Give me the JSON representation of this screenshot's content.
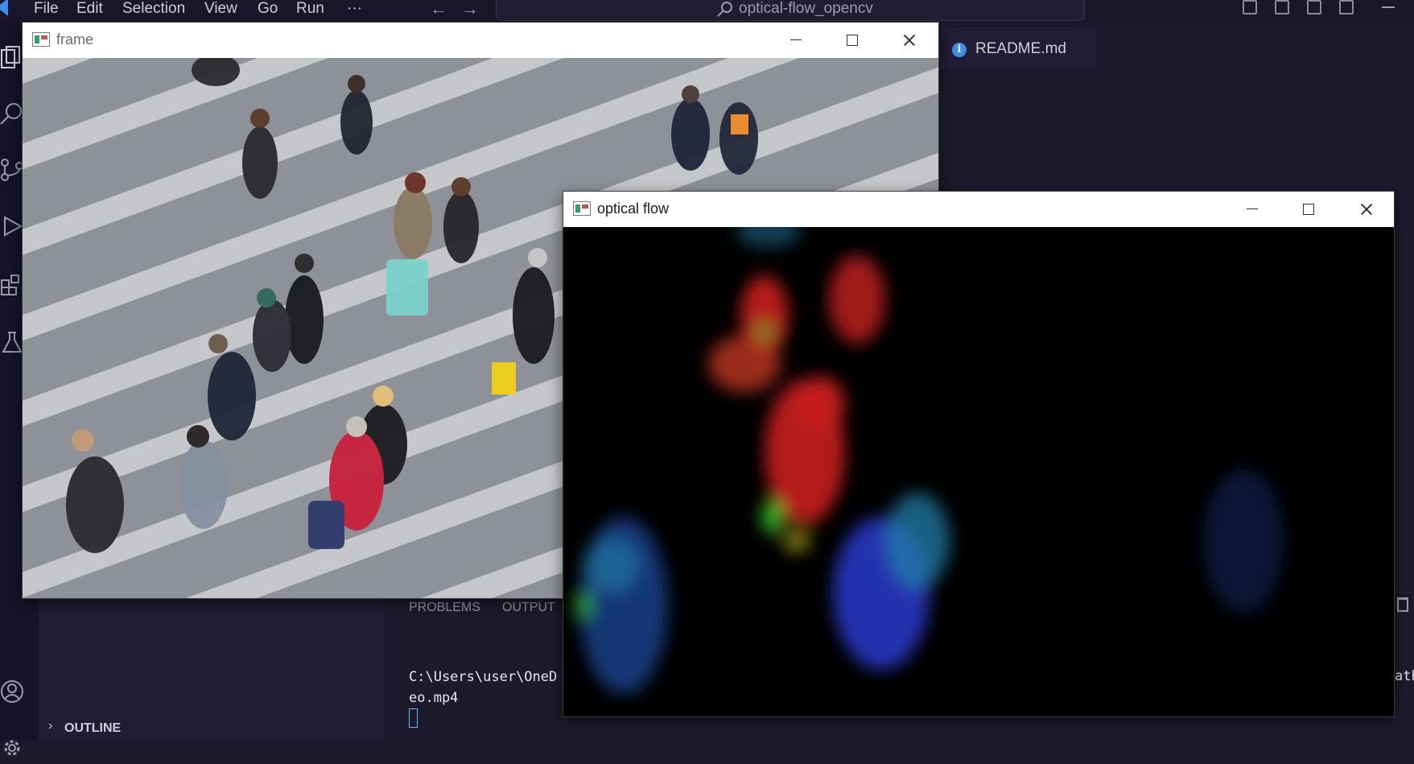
{
  "menu": {
    "file": "File",
    "edit": "Edit",
    "selection": "Selection",
    "view": "View",
    "go": "Go",
    "run": "Run",
    "more": "···"
  },
  "command_center": {
    "text": "optical-flow_opencv",
    "icon": "search-icon"
  },
  "editor": {
    "tab_label": "README.md",
    "tab_icon": "info-icon"
  },
  "sidebar": {
    "outline_label": "OUTLINE"
  },
  "panel": {
    "tabs": [
      "PROBLEMS",
      "OUTPUT"
    ],
    "terminal_lines": [
      "C:\\Users\\user\\OneD",
      "eo.mp4"
    ],
    "overflow_text": "ath"
  },
  "frame_window": {
    "title": "frame"
  },
  "flow_window": {
    "title": "optical flow"
  },
  "colors": {
    "accent": "#3b8eea",
    "window_titlebar": "#ffffff",
    "flow_red": "#c81e1e",
    "flow_blue": "#2a3acc",
    "flow_teal": "#1f7fa8",
    "flow_green": "#39d12b"
  }
}
